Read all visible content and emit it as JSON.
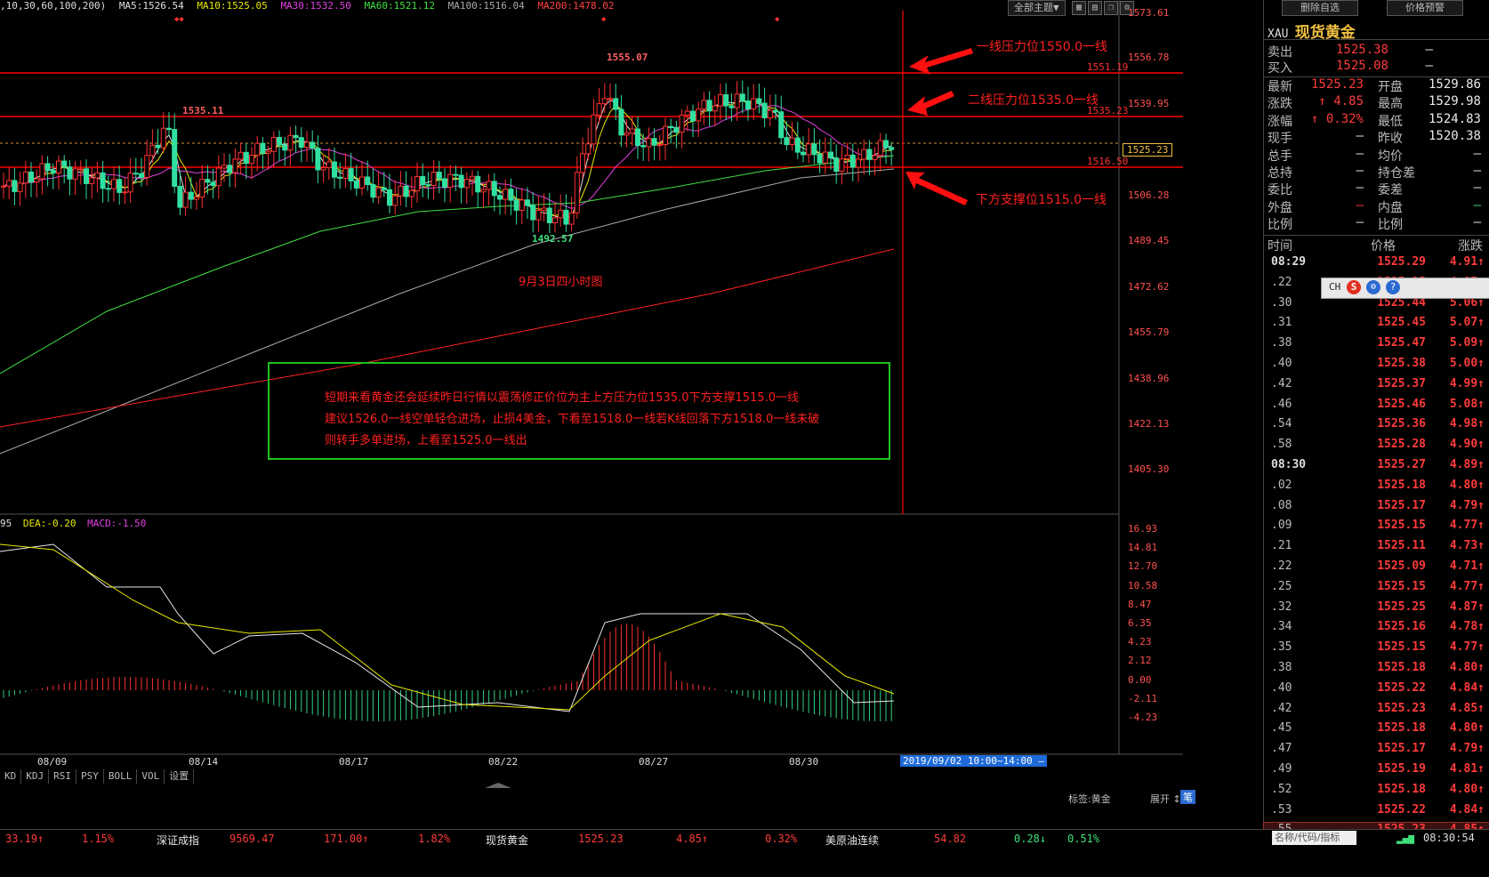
{
  "ma_legend": {
    "prefix": ",10,30,60,100,200)",
    "ma5": "MA5:1526.54",
    "ma10": "MA10:1525.05",
    "ma30": "MA30:1532.50",
    "ma60": "MA60:1521.12",
    "ma100": "MA100:1516.04",
    "ma200": "MA200:1478.02"
  },
  "toolbar": {
    "theme_label": "全部主题▼",
    "delete_watch_label": "删除自选",
    "price_alert_label": "价格预警"
  },
  "price_axis": [
    "1573.61",
    "1556.78",
    "1539.95",
    "1523.12",
    "1506.28",
    "1489.45",
    "1472.62",
    "1455.79",
    "1438.96",
    "1422.13",
    "1405.30"
  ],
  "level_tags": {
    "l1": "1551.19",
    "l2": "1535.23",
    "current": "1525.23",
    "l3": "1516.50"
  },
  "chart_labels": {
    "high_a": "1535.11",
    "high_b": "1555.07",
    "low": "1492.57",
    "title": "9月3日四小时图"
  },
  "annotations": {
    "resist1": "一线压力位1550.0一线",
    "resist2": "二线压力位1535.0一线",
    "support": "下方支撑位1515.0一线",
    "box_line1": "短期来看黄金还会延续昨日行情以震荡修正价位为主上方压力位1535.0下方支撑1515.0一线",
    "box_line2": "建议1526.0一线空单轻仓进场，止损4美金，下看至1518.0一线若K线回落下方1518.0一线未破",
    "box_line3": "则转手多单进场，上看至1525.0一线出"
  },
  "macd_legend": {
    "prefix": "95",
    "dea": "DEA:-0.20",
    "macd": "MACD:-1.50"
  },
  "macd_axis": [
    "16.93",
    "14.81",
    "12.70",
    "10.58",
    "8.47",
    "6.35",
    "4.23",
    "2.12",
    "0.00",
    "-2.11",
    "-4.23"
  ],
  "date_axis": [
    "08/09",
    "08/14",
    "08/17",
    "08/22",
    "08/27",
    "08/30"
  ],
  "crosshair_date": "2019/09/02 10:00~14:00 —",
  "indicator_tabs": [
    "KD",
    "KDJ",
    "RSI",
    "PSY",
    "BOLL",
    "VOL",
    "设置"
  ],
  "quote": {
    "symbol": "XAU",
    "name": "现货黄金",
    "sell_label": "卖出",
    "sell": "1525.38",
    "sell_vol": "—",
    "buy_label": "买入",
    "buy": "1525.08",
    "buy_vol": "—",
    "rows": [
      {
        "l1": "最新",
        "v1": "1525.23",
        "c1": "red",
        "l2": "开盘",
        "v2": "1529.86",
        "c2": "white"
      },
      {
        "l1": "涨跌",
        "v1": "↑ 4.85",
        "c1": "red",
        "l2": "最高",
        "v2": "1529.98",
        "c2": "white"
      },
      {
        "l1": "涨幅",
        "v1": "↑ 0.32%",
        "c1": "red",
        "l2": "最低",
        "v2": "1524.83",
        "c2": "white"
      },
      {
        "l1": "现手",
        "v1": "—",
        "c1": "white",
        "l2": "昨收",
        "v2": "1520.38",
        "c2": "white"
      },
      {
        "l1": "总手",
        "v1": "—",
        "c1": "white",
        "l2": "均价",
        "v2": "—",
        "c2": "white"
      },
      {
        "l1": "总持",
        "v1": "—",
        "c1": "white",
        "l2": "持仓差",
        "v2": "—",
        "c2": "white"
      },
      {
        "l1": "委比",
        "v1": "—",
        "c1": "white",
        "l2": "委差",
        "v2": "—",
        "c2": "white"
      },
      {
        "l1": "外盘",
        "v1": "—",
        "c1": "red",
        "l2": "内盘",
        "v2": "—",
        "c2": "green"
      },
      {
        "l1": "比例",
        "v1": "—",
        "c1": "white",
        "l2": "比例",
        "v2": "—",
        "c2": "white"
      }
    ],
    "tick_header": {
      "time": "时间",
      "price": "价格",
      "chg": "涨跌"
    },
    "ticks": [
      {
        "t": "08:29",
        "p": "1525.29",
        "c": "4.91↑"
      },
      {
        "t": ".22",
        "p": "1525.25",
        "c": "4.87↑"
      },
      {
        "t": ".30",
        "p": "1525.44",
        "c": "5.06↑"
      },
      {
        "t": ".31",
        "p": "1525.45",
        "c": "5.07↑"
      },
      {
        "t": ".38",
        "p": "1525.47",
        "c": "5.09↑"
      },
      {
        "t": ".40",
        "p": "1525.38",
        "c": "5.00↑"
      },
      {
        "t": ".42",
        "p": "1525.37",
        "c": "4.99↑"
      },
      {
        "t": ".46",
        "p": "1525.46",
        "c": "5.08↑"
      },
      {
        "t": ".54",
        "p": "1525.36",
        "c": "4.98↑"
      },
      {
        "t": ".58",
        "p": "1525.28",
        "c": "4.90↑"
      },
      {
        "t": "08:30",
        "p": "1525.27",
        "c": "4.89↑"
      },
      {
        "t": ".02",
        "p": "1525.18",
        "c": "4.80↑"
      },
      {
        "t": ".08",
        "p": "1525.17",
        "c": "4.79↑"
      },
      {
        "t": ".09",
        "p": "1525.15",
        "c": "4.77↑"
      },
      {
        "t": ".21",
        "p": "1525.11",
        "c": "4.73↑"
      },
      {
        "t": ".22",
        "p": "1525.09",
        "c": "4.71↑"
      },
      {
        "t": ".25",
        "p": "1525.15",
        "c": "4.77↑"
      },
      {
        "t": ".32",
        "p": "1525.25",
        "c": "4.87↑"
      },
      {
        "t": ".34",
        "p": "1525.16",
        "c": "4.78↑"
      },
      {
        "t": ".35",
        "p": "1525.15",
        "c": "4.77↑"
      },
      {
        "t": ".38",
        "p": "1525.18",
        "c": "4.80↑"
      },
      {
        "t": ".40",
        "p": "1525.22",
        "c": "4.84↑"
      },
      {
        "t": ".42",
        "p": "1525.23",
        "c": "4.85↑"
      },
      {
        "t": ".45",
        "p": "1525.18",
        "c": "4.80↑"
      },
      {
        "t": ".47",
        "p": "1525.17",
        "c": "4.79↑"
      },
      {
        "t": ".49",
        "p": "1525.19",
        "c": "4.81↑"
      },
      {
        "t": ".52",
        "p": "1525.18",
        "c": "4.80↑"
      },
      {
        "t": ".53",
        "p": "1525.22",
        "c": "4.84↑"
      },
      {
        "t": ".55",
        "p": "1525.23",
        "c": "4.85↑"
      }
    ],
    "ime_label": "CH",
    "tag_label": "标签:黄金",
    "expand_label": "展开 ↕",
    "pen_label": "笔"
  },
  "ticker": [
    {
      "v": "33.19↑",
      "c": "red"
    },
    {
      "v": "1.15%",
      "c": "red"
    },
    {
      "v": "深证成指",
      "c": "white"
    },
    {
      "v": "9569.47",
      "c": "red"
    },
    {
      "v": "171.00↑",
      "c": "red"
    },
    {
      "v": "1.82%",
      "c": "red"
    },
    {
      "v": "现货黄金",
      "c": "white"
    },
    {
      "v": "1525.23",
      "c": "red"
    },
    {
      "v": "4.85↑",
      "c": "red"
    },
    {
      "v": "0.32%",
      "c": "red"
    },
    {
      "v": "美原油连续",
      "c": "white"
    },
    {
      "v": "54.82",
      "c": "red"
    },
    {
      "v": "0.28↓",
      "c": "green"
    },
    {
      "v": "0.51%",
      "c": "green"
    }
  ],
  "search_placeholder": "名称/代码/指标",
  "clock": "08:30:54"
}
